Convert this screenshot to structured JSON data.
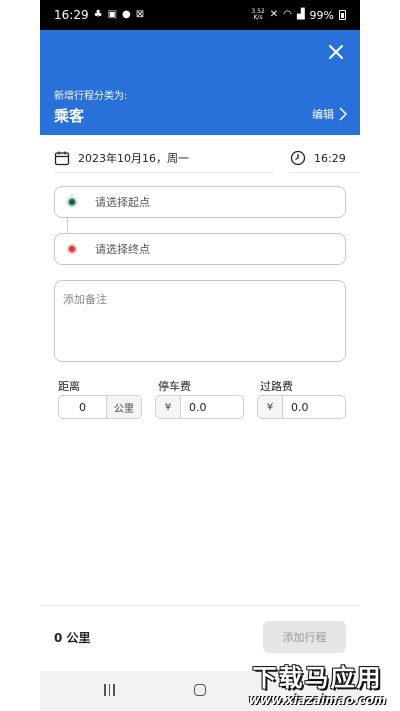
{
  "status_bar": {
    "time": "16:29",
    "speed": "3.52\nK/s",
    "battery": "99%"
  },
  "header": {
    "subtitle": "新增行程分类为:",
    "title": "乘客",
    "edit_label": "编辑",
    "bg_color": "#2871d8"
  },
  "trip": {
    "date": "2023年10月16，周一",
    "time": "16:29"
  },
  "locations": {
    "start_placeholder": "请选择起点",
    "end_placeholder": "请选择终点"
  },
  "notes": {
    "placeholder": "添加备注"
  },
  "fees": {
    "distance_label": "距离",
    "distance_value": "0",
    "distance_unit": "公里",
    "parking_label": "停车费",
    "parking_currency": "¥",
    "parking_value": "0.0",
    "toll_label": "过路费",
    "toll_currency": "¥",
    "toll_value": "0.0"
  },
  "footer": {
    "total": "0 公里",
    "add_button": "添加行程"
  },
  "watermark": {
    "cn": "下载马应用",
    "en": "www.xiazaimao.com"
  }
}
